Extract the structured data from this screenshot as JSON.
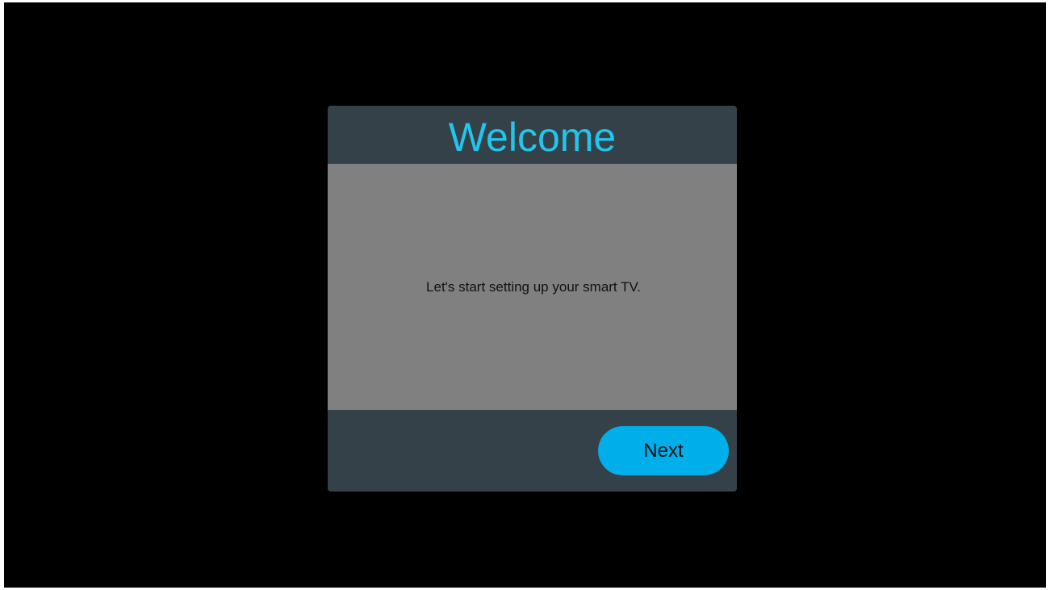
{
  "dialog": {
    "title": "Welcome",
    "message": "Let's start setting up your smart TV.",
    "next_label": "Next"
  },
  "colors": {
    "background": "#000000",
    "dialog_frame": "#344148",
    "dialog_body": "#808080",
    "accent": "#22c6ec",
    "button": "#00aeea"
  }
}
